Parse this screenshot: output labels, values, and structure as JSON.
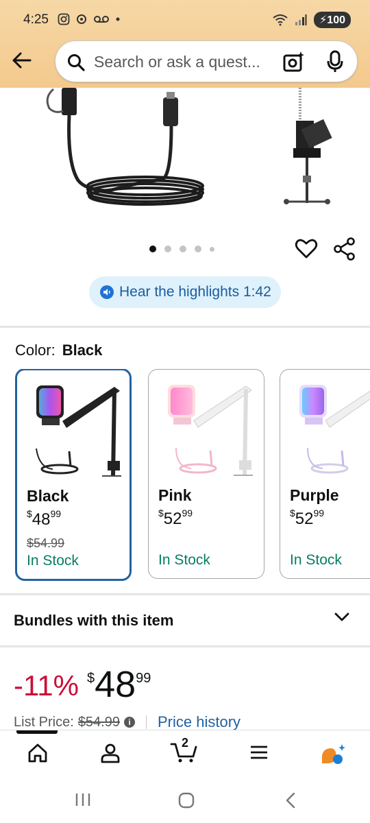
{
  "status_bar": {
    "time": "4:25",
    "battery": "100"
  },
  "search": {
    "placeholder": "Search or ask a quest..."
  },
  "gallery": {
    "total_images": 5,
    "active_index": 0
  },
  "highlights": {
    "label": "Hear the highlights 1:42"
  },
  "color_selector": {
    "label": "Color:",
    "selected": "Black",
    "options": [
      {
        "name": "Black",
        "price_dollar": "$",
        "price_whole": "48",
        "price_cents": "99",
        "list_price": "$54.99",
        "stock": "In Stock"
      },
      {
        "name": "Pink",
        "price_dollar": "$",
        "price_whole": "52",
        "price_cents": "99",
        "list_price": "",
        "stock": "In Stock"
      },
      {
        "name": "Purple",
        "price_dollar": "$",
        "price_whole": "52",
        "price_cents": "99",
        "list_price": "",
        "stock": "In Stock"
      }
    ]
  },
  "bundles": {
    "title": "Bundles with this item"
  },
  "price": {
    "discount": "-11%",
    "currency": "$",
    "whole": "48",
    "cents": "99",
    "list_label": "List Price:",
    "list_value": "$54.99",
    "history_link": "Price history"
  },
  "bottom_nav": {
    "cart_count": "2"
  },
  "colors": {
    "accent": "#2162a1",
    "discount": "#cc0c39",
    "stock": "#067d62",
    "header": "#f3c98d"
  }
}
